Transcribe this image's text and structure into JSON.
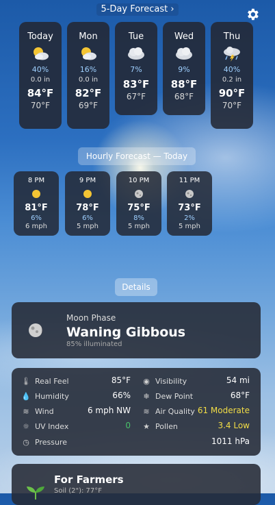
{
  "header": {
    "title": "5-Day Forecast ›"
  },
  "days": [
    {
      "name": "Today",
      "icon": "partly-sunny-icon",
      "precip_chance": "40%",
      "precip_amount": "0.0 in",
      "high": "84°F",
      "low": "70°F"
    },
    {
      "name": "Mon",
      "icon": "partly-sunny-icon",
      "precip_chance": "16%",
      "precip_amount": "0.0 in",
      "high": "82°F",
      "low": "69°F"
    },
    {
      "name": "Tue",
      "icon": "cloud-icon",
      "precip_chance": "7%",
      "precip_amount": "",
      "high": "83°F",
      "low": "67°F"
    },
    {
      "name": "Wed",
      "icon": "cloud-icon",
      "precip_chance": "9%",
      "precip_amount": "",
      "high": "88°F",
      "low": "68°F"
    },
    {
      "name": "Thu",
      "icon": "thunderstorm-icon",
      "precip_chance": "40%",
      "precip_amount": "0.2 in",
      "high": "90°F",
      "low": "70°F"
    }
  ],
  "hourly": {
    "title": "Hourly Forecast — Today",
    "items": [
      {
        "time": "8 PM",
        "icon": "sun-icon",
        "temp": "81°F",
        "precip": "6%",
        "wind": "6 mph"
      },
      {
        "time": "9 PM",
        "icon": "sun-icon",
        "temp": "78°F",
        "precip": "6%",
        "wind": "5 mph"
      },
      {
        "time": "10 PM",
        "icon": "moon-icon",
        "temp": "75°F",
        "precip": "8%",
        "wind": "5 mph"
      },
      {
        "time": "11 PM",
        "icon": "moon-icon",
        "temp": "73°F",
        "precip": "2%",
        "wind": "5 mph"
      }
    ]
  },
  "details_label": "Details",
  "moon": {
    "label": "Moon Phase",
    "phase": "Waning Gibbous",
    "illumination": "85% illuminated"
  },
  "details": {
    "left": [
      {
        "icon": "thermometer-icon",
        "label": "Real Feel",
        "value": "85°F"
      },
      {
        "icon": "droplet-icon",
        "label": "Humidity",
        "value": "66%"
      },
      {
        "icon": "wind-icon",
        "label": "Wind",
        "value": "6 mph NW"
      },
      {
        "icon": "uv-icon",
        "label": "UV Index",
        "value": "0",
        "color": "#49c06a"
      },
      {
        "icon": "gauge-icon",
        "label": "Pressure",
        "value": ""
      }
    ],
    "right": [
      {
        "icon": "eye-icon",
        "label": "Visibility",
        "value": "54 mi"
      },
      {
        "icon": "snowflake-icon",
        "label": "Dew Point",
        "value": "68°F"
      },
      {
        "icon": "air-icon",
        "label": "Air Quality",
        "value": "61 Moderate",
        "color": "#f2dd46"
      },
      {
        "icon": "star-icon",
        "label": "Pollen",
        "value": "3.4 Low",
        "color": "#f2dd46"
      }
    ],
    "pressure_value": "1011 hPa"
  },
  "farmers": {
    "title": "For Farmers",
    "subtitle": "Soil (2\"): 77°F"
  }
}
